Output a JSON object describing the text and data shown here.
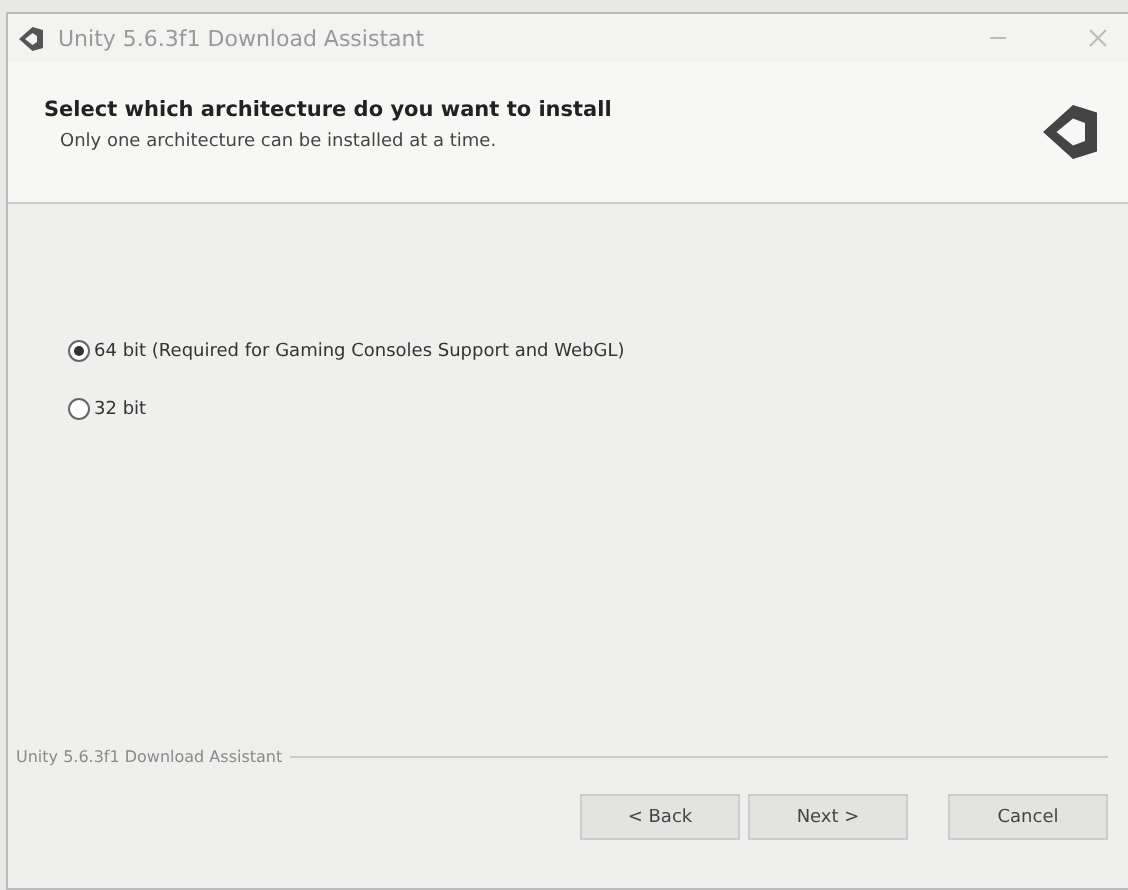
{
  "window": {
    "title": "Unity 5.6.3f1 Download Assistant"
  },
  "header": {
    "title": "Select which architecture do you want to install",
    "subtitle": "Only one architecture can be installed at a time."
  },
  "options": [
    {
      "label": "64 bit (Required for Gaming Consoles Support and WebGL)",
      "selected": true
    },
    {
      "label": "32 bit",
      "selected": false
    }
  ],
  "footer": {
    "label": "Unity 5.6.3f1 Download Assistant"
  },
  "buttons": [
    "< Back",
    "Next >",
    "Cancel"
  ]
}
